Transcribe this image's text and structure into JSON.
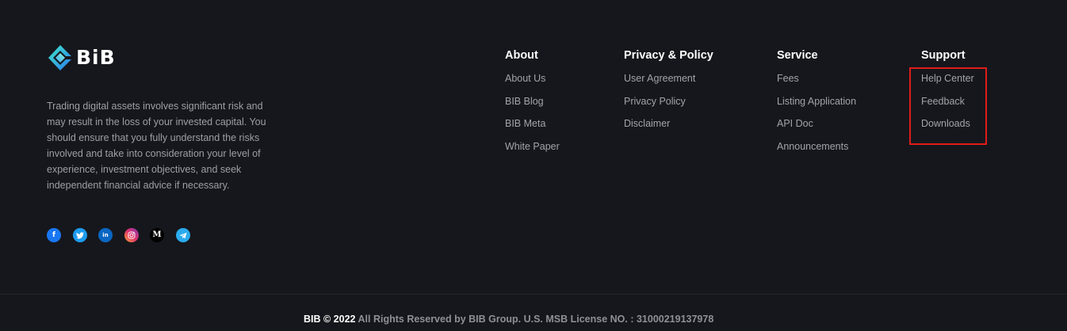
{
  "brand": {
    "logo_text": "BiB",
    "disclaimer": "Trading digital assets involves significant risk and may result in the loss of your invested capital. You should ensure that you fully understand the risks involved and take into consideration your level of experience, investment objectives, and seek independent financial advice if necessary."
  },
  "social": [
    {
      "name": "facebook-icon",
      "glyph": "f"
    },
    {
      "name": "twitter-icon",
      "glyph": "t"
    },
    {
      "name": "linkedin-icon",
      "glyph": "in"
    },
    {
      "name": "instagram-icon",
      "glyph": "◎"
    },
    {
      "name": "medium-icon",
      "glyph": "M"
    },
    {
      "name": "telegram-icon",
      "glyph": "➤"
    }
  ],
  "columns": {
    "about": {
      "title": "About",
      "links": [
        "About Us",
        "BIB Blog",
        "BIB Meta",
        "White Paper"
      ]
    },
    "privacy": {
      "title": "Privacy & Policy",
      "links": [
        "User Agreement",
        "Privacy Policy",
        "Disclaimer"
      ]
    },
    "service": {
      "title": "Service",
      "links": [
        "Fees",
        "Listing Application",
        "API Doc",
        "Announcements"
      ]
    },
    "support": {
      "title": "Support",
      "links": [
        "Help Center",
        "Feedback",
        "Downloads"
      ]
    }
  },
  "footer": {
    "brand": "BIB © 2022",
    "rights": " All Rights Reserved by BIB Group. U.S. MSB License NO. : 31000219137978"
  },
  "colors": {
    "background": "#16171c",
    "highlight": "#e01b1b",
    "logo_gradient_start": "#35e6c8",
    "logo_gradient_end": "#2a7bf0"
  }
}
